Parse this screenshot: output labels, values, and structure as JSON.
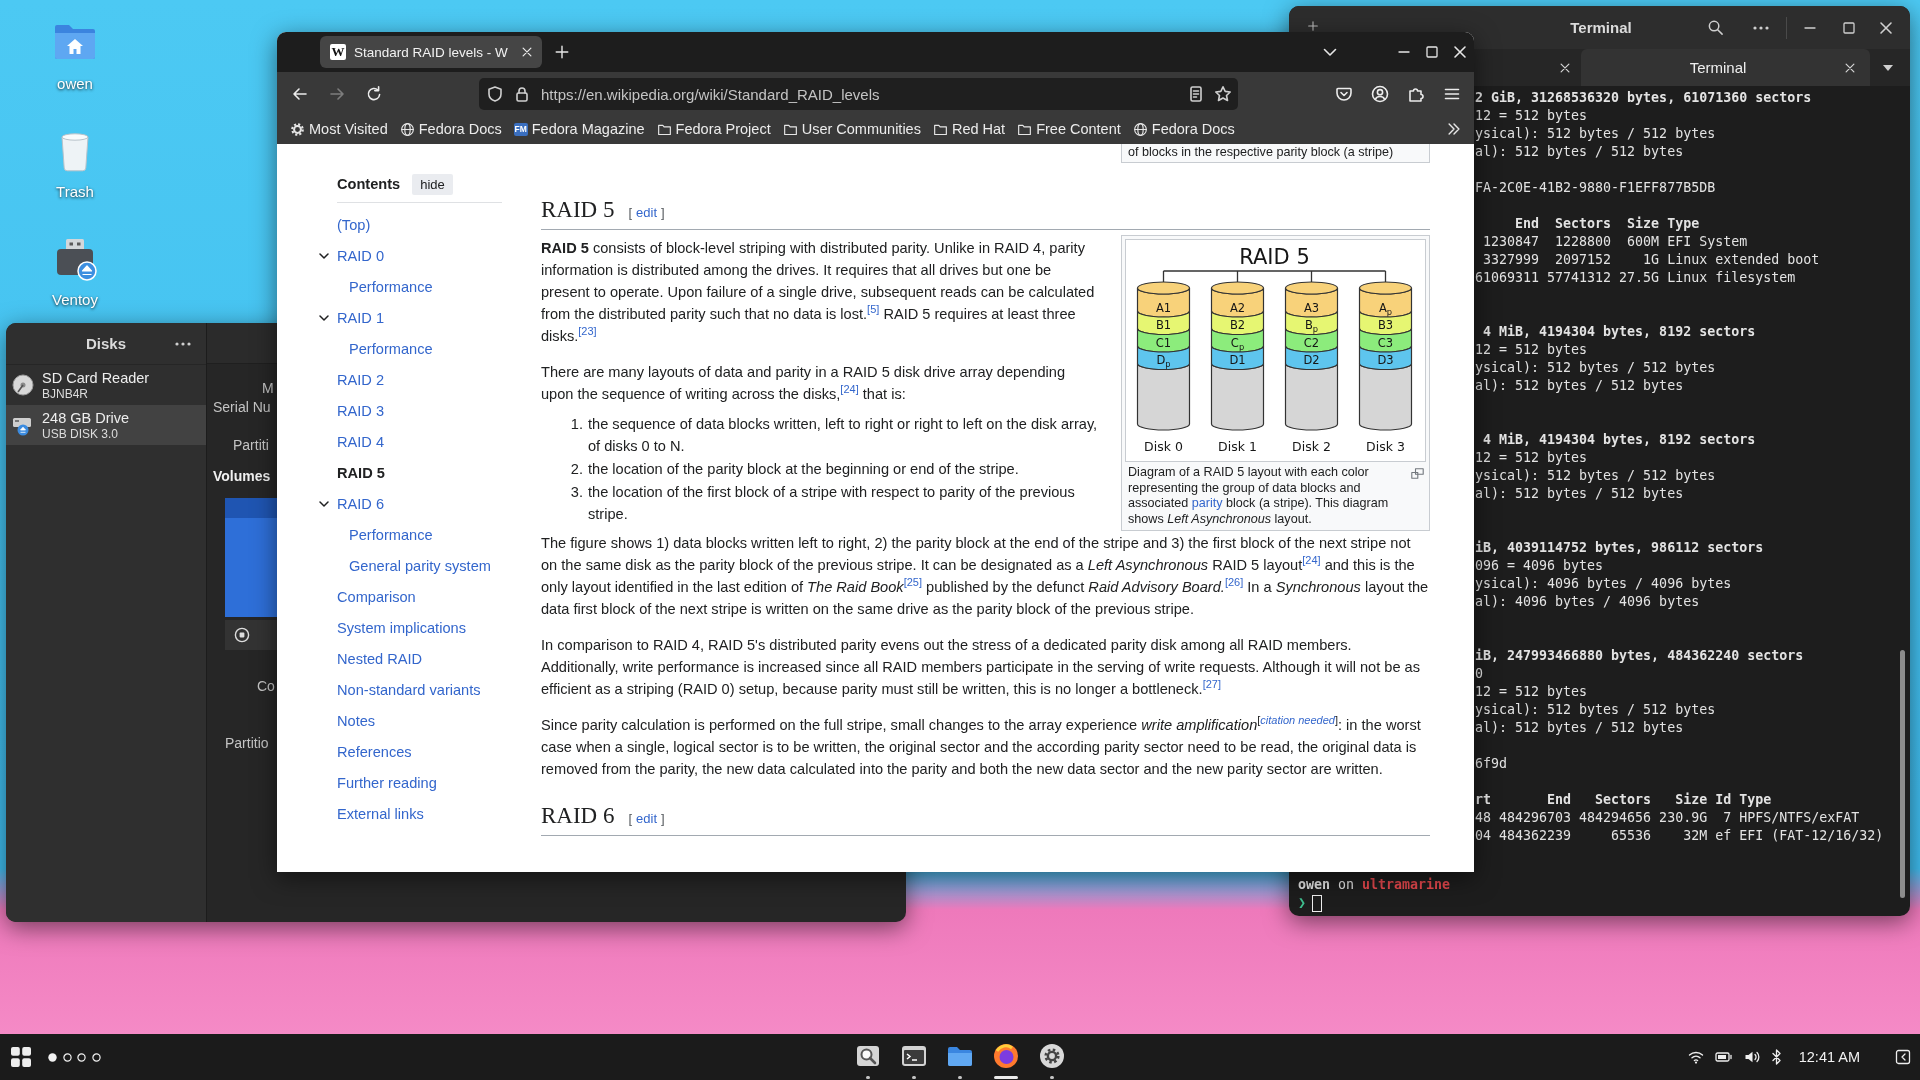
{
  "desktop": {
    "icons": [
      {
        "label": "owen",
        "kind": "home-folder"
      },
      {
        "label": "Trash",
        "kind": "trash"
      },
      {
        "label": "Ventoy",
        "kind": "usb-drive"
      }
    ]
  },
  "disks_window": {
    "title": "Disks",
    "drives": [
      {
        "name": "SD Card Reader",
        "detail": "BJNB4R",
        "kind": "card-reader",
        "selected": false
      },
      {
        "name": "248 GB Drive",
        "detail": "USB DISK 3.0",
        "kind": "usb-drive",
        "selected": true
      }
    ],
    "details": [
      "M",
      "Serial Nu",
      "Partiti"
    ],
    "volumes_heading": "Volumes",
    "details_lower": [
      "Co",
      "Partitio"
    ]
  },
  "browser": {
    "tabs": [
      {
        "favicon": "W",
        "title": "Standard RAID levels - W",
        "selected": true
      }
    ],
    "back_disabled": false,
    "forward_disabled": true,
    "url": "https://en.wikipedia.org/wiki/Standard_RAID_levels",
    "bookmarks": [
      {
        "label": "Most Visited",
        "kind": "gear"
      },
      {
        "label": "Fedora Docs",
        "kind": "globe"
      },
      {
        "label": "Fedora Magazine",
        "kind": "badge",
        "badge": "FM"
      },
      {
        "label": "Fedora Project",
        "kind": "folder"
      },
      {
        "label": "User Communities",
        "kind": "folder"
      },
      {
        "label": "Red Hat",
        "kind": "folder"
      },
      {
        "label": "Free Content",
        "kind": "folder"
      },
      {
        "label": "Fedora Docs",
        "kind": "globe"
      }
    ],
    "page": {
      "toc": {
        "title": "Contents",
        "toggle": "hide",
        "items": [
          {
            "label": "(Top)",
            "selected": false
          },
          {
            "label": "RAID 0",
            "selected": false,
            "expanded": true,
            "children": [
              {
                "label": "Performance",
                "selected": false
              }
            ]
          },
          {
            "label": "RAID 1",
            "selected": false,
            "expanded": true,
            "children": [
              {
                "label": "Performance",
                "selected": false
              }
            ]
          },
          {
            "label": "RAID 2",
            "selected": false
          },
          {
            "label": "RAID 3",
            "selected": false
          },
          {
            "label": "RAID 4",
            "selected": false
          },
          {
            "label": "RAID 5",
            "selected": true
          },
          {
            "label": "RAID 6",
            "selected": false,
            "expanded": true,
            "children": [
              {
                "label": "Performance",
                "selected": false
              },
              {
                "label": "General parity system",
                "selected": false
              }
            ]
          },
          {
            "label": "Comparison",
            "selected": false
          },
          {
            "label": "System implications",
            "selected": false
          },
          {
            "label": "Nested RAID",
            "selected": false
          },
          {
            "label": "Non-standard variants",
            "selected": false
          },
          {
            "label": "Notes",
            "selected": false
          },
          {
            "label": "References",
            "selected": false
          },
          {
            "label": "Further reading",
            "selected": false
          },
          {
            "label": "External links",
            "selected": false
          }
        ]
      },
      "previous_caption": "of blocks in the respective parity block (a stripe)",
      "sections": [
        {
          "heading": "RAID 5",
          "edit": {
            "open": "[",
            "label": "edit",
            "close": "]"
          },
          "figure": {
            "title": "RAID 5",
            "disks": [
              {
                "label": "Disk 0",
                "blocks": [
                  {
                    "label": "A1",
                    "color": "#f8d27a"
                  },
                  {
                    "label": "B1",
                    "color": "#e6f672"
                  },
                  {
                    "label": "C1",
                    "color": "#8cec7c"
                  },
                  {
                    "label": "D$_{p}$",
                    "color": "#5ec5ee"
                  }
                ]
              },
              {
                "label": "Disk 1",
                "blocks": [
                  {
                    "label": "A2",
                    "color": "#f8d27a"
                  },
                  {
                    "label": "B2",
                    "color": "#e6f672"
                  },
                  {
                    "label": "C$_{p}$",
                    "color": "#8cec7c"
                  },
                  {
                    "label": "D1",
                    "color": "#5ec5ee"
                  }
                ]
              },
              {
                "label": "Disk 2",
                "blocks": [
                  {
                    "label": "A3",
                    "color": "#f8d27a"
                  },
                  {
                    "label": "B$_{p}$",
                    "color": "#e6f672"
                  },
                  {
                    "label": "C2",
                    "color": "#8cec7c"
                  },
                  {
                    "label": "D2",
                    "color": "#5ec5ee"
                  }
                ]
              },
              {
                "label": "Disk 3",
                "blocks": [
                  {
                    "label": "A$_{p}$",
                    "color": "#f8d27a"
                  },
                  {
                    "label": "B3",
                    "color": "#e6f672"
                  },
                  {
                    "label": "C3",
                    "color": "#8cec7c"
                  },
                  {
                    "label": "D3",
                    "color": "#5ec5ee"
                  }
                ]
              }
            ],
            "caption": [
              {
                "kind": "text",
                "text": "Diagram of a RAID 5 layout with each color representing the group of data blocks and associated "
              },
              {
                "kind": "link",
                "text": "parity"
              },
              {
                "kind": "text",
                "text": " block (a stripe). This diagram shows *Left Asynchronous* layout."
              }
            ]
          },
          "body": [
            {
              "kind": "paragraph",
              "parts": [
                {
                  "kind": "text",
                  "text": "**RAID 5** consists of block-level striping with distributed parity. Unlike in RAID 4, parity information is distributed among the drives. It requires that all drives but one be present to operate. Upon failure of a single drive, subsequent reads can be calculated from the distributed parity such that no data is lost."
                },
                {
                  "kind": "ref",
                  "text": "[5]"
                },
                {
                  "kind": "text",
                  "text": " RAID 5 requires at least three disks."
                },
                {
                  "kind": "ref",
                  "text": "[23]"
                }
              ]
            },
            {
              "kind": "paragraph",
              "parts": [
                {
                  "kind": "text",
                  "text": "There are many layouts of data and parity in a RAID 5 disk drive array depending upon the sequence of writing across the disks,"
                },
                {
                  "kind": "ref",
                  "text": "[24]"
                },
                {
                  "kind": "text",
                  "text": " that is:"
                }
              ]
            },
            {
              "kind": "list",
              "items": [
                {
                  "number": "1.",
                  "text": "the sequence of data blocks written, left to right or right to left on the disk array, of disks 0 to N."
                },
                {
                  "number": "2.",
                  "text": "the location of the parity block at the beginning or end of the stripe."
                },
                {
                  "number": "3.",
                  "text": "the location of the first block of a stripe with respect to parity of the previous stripe."
                }
              ]
            },
            {
              "kind": "paragraph",
              "parts": [
                {
                  "kind": "text",
                  "text": "The figure shows 1) data blocks written left to right, 2) the parity block at the end of the stripe and 3) the first block of the next stripe not on the same disk as the parity block of the previous stripe. It can be designated as a *Left Asynchronous* RAID 5 layout"
                },
                {
                  "kind": "ref",
                  "text": "[24]"
                },
                {
                  "kind": "text",
                  "text": " and this is the only layout identified in the last edition of *The Raid Book*"
                },
                {
                  "kind": "ref",
                  "text": "[25]"
                },
                {
                  "kind": "text",
                  "text": " published by the defunct *Raid Advisory Board.*"
                },
                {
                  "kind": "ref",
                  "text": "[26]"
                },
                {
                  "kind": "text",
                  "text": " In a *Synchronous* layout the data first block of the next stripe is written on the same drive as the parity block of the previous stripe."
                }
              ]
            },
            {
              "kind": "paragraph",
              "parts": [
                {
                  "kind": "text",
                  "text": "In comparison to RAID 4, RAID 5's distributed parity evens out the stress of a dedicated parity disk among all RAID members. Additionally, write performance is increased since all RAID members participate in the serving of write requests. Although it will not be as efficient as a striping (RAID 0) setup, because parity must still be written, this is no longer a bottleneck."
                },
                {
                  "kind": "ref",
                  "text": "[27]"
                }
              ]
            },
            {
              "kind": "paragraph",
              "parts": [
                {
                  "kind": "text",
                  "text": "Since parity calculation is performed on the full stripe, small changes to the array experience *write amplification*$^{[}$"
                },
                {
                  "kind": "note",
                  "text": "citation needed"
                },
                {
                  "kind": "text",
                  "text": "$^{]}$: in the worst case when a single, logical sector is to be written, the original sector and the according parity sector need to be read, the original data is removed from the parity, the new data calculated into the parity and both the new data sector and the new parity sector are written."
                }
              ]
            }
          ]
        },
        {
          "heading": "RAID 6",
          "edit": {
            "open": "[",
            "label": "edit",
            "close": "]"
          }
        }
      ]
    }
  },
  "terminal": {
    "title": "Terminal",
    "tabs": [
      {
        "selected": false
      },
      {
        "label": "Terminal",
        "selected": true
      }
    ],
    "output": [
      {
        "blocks": [
          [
            {
              "text": "2 GiB, 31268536320 bytes, 61071360 sectors",
              "bold": true
            },
            {
              "text": "12 = 512 bytes",
              "bold": false
            },
            {
              "text": "ysical): 512 bytes / 512 bytes",
              "bold": false
            },
            {
              "text": "al): 512 bytes / 512 bytes",
              "bold": false
            }
          ],
          [
            {
              "text": "FA-2C0E-41B2-9880-F1EFF877B5DB",
              "bold": false
            }
          ],
          [
            {
              "text": "     End  Sectors  Size Type",
              "bold": true
            },
            {
              "text": " 1230847  1228800  600M EFI System",
              "bold": false
            },
            {
              "text": " 3327999  2097152    1G Linux extended boot",
              "bold": false
            },
            {
              "text": "61069311 57741312 27.5G Linux filesystem",
              "bold": false
            }
          ]
        ]
      },
      {
        "blocks": [
          [
            {
              "text": " 4 MiB, 4194304 bytes, 8192 sectors",
              "bold": true
            },
            {
              "text": "12 = 512 bytes",
              "bold": false
            },
            {
              "text": "ysical): 512 bytes / 512 bytes",
              "bold": false
            },
            {
              "text": "al): 512 bytes / 512 bytes",
              "bold": false
            }
          ]
        ]
      },
      {
        "blocks": [
          [
            {
              "text": " 4 MiB, 4194304 bytes, 8192 sectors",
              "bold": true
            },
            {
              "text": "12 = 512 bytes",
              "bold": false
            },
            {
              "text": "ysical): 512 bytes / 512 bytes",
              "bold": false
            },
            {
              "text": "al): 512 bytes / 512 bytes",
              "bold": false
            }
          ]
        ]
      },
      {
        "blocks": [
          [
            {
              "text": "iB, 4039114752 bytes, 986112 sectors",
              "bold": true
            },
            {
              "text": "096 = 4096 bytes",
              "bold": false
            },
            {
              "text": "ysical): 4096 bytes / 4096 bytes",
              "bold": false
            },
            {
              "text": "al): 4096 bytes / 4096 bytes",
              "bold": false
            }
          ]
        ]
      },
      {
        "blocks": [
          [
            {
              "text": "iB, 247993466880 bytes, 484362240 sectors",
              "bold": true
            },
            {
              "text": "0",
              "bold": false
            },
            {
              "text": "12 = 512 bytes",
              "bold": false
            },
            {
              "text": "ysical): 512 bytes / 512 bytes",
              "bold": false
            },
            {
              "text": "al): 512 bytes / 512 bytes",
              "bold": false
            }
          ],
          [
            {
              "text": "6f9d",
              "bold": false
            }
          ],
          [
            {
              "text": "rt       End   Sectors   Size Id Type",
              "bold": true
            },
            {
              "text": "48 484296703 484294656 230.9G  7 HPFS/NTFS/exFAT",
              "bold": false
            },
            {
              "text": "04 484362239     65536    32M ef EFI (FAT-12/16/32)",
              "bold": false
            }
          ]
        ]
      }
    ],
    "prompt": {
      "user": "owen",
      "separator": "on",
      "host": "ultramarine",
      "symbol": "❯"
    }
  },
  "taskbar": {
    "workspaces": [
      {
        "selected": true
      },
      {
        "selected": false
      },
      {
        "selected": false
      },
      {
        "selected": false
      }
    ],
    "apps": [
      {
        "kind": "disks",
        "running": true,
        "focused": false
      },
      {
        "kind": "terminal",
        "running": true,
        "focused": false
      },
      {
        "kind": "files",
        "running": true,
        "focused": false
      },
      {
        "kind": "browser",
        "running": true,
        "focused": true
      },
      {
        "kind": "settings",
        "running": true,
        "focused": false
      }
    ],
    "clock": "12:41 AM"
  }
}
